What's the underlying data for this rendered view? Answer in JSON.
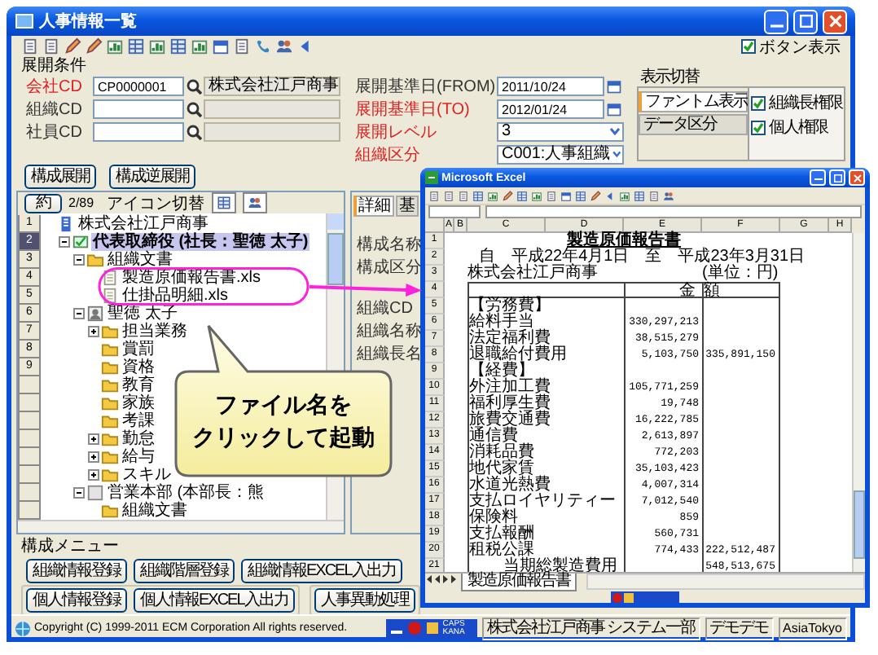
{
  "window": {
    "title": "人事情報一覧"
  },
  "button_display": {
    "label": "ボタン表示",
    "checked": true
  },
  "conditions": {
    "heading": "展開条件",
    "left": [
      {
        "label": "会社CD",
        "required": true,
        "value": "CP0000001",
        "name": "株式会社江戸商事"
      },
      {
        "label": "組織CD",
        "required": false
      },
      {
        "label": "社員CD",
        "required": false
      }
    ],
    "right": [
      {
        "label": "展開基準日(FROM)",
        "required": false,
        "kind": "date",
        "value": "2011/10/24"
      },
      {
        "label": "展開基準日(TO)",
        "required": true,
        "kind": "date",
        "value": "2012/01/24"
      },
      {
        "label": "展開レベル",
        "required": true,
        "kind": "select",
        "value": "3"
      },
      {
        "label": "組織区分",
        "required": true,
        "kind": "select",
        "value": "C001:人事組織"
      }
    ]
  },
  "display_switch": {
    "heading": "表示切替",
    "tabs": [
      {
        "label": "ファントム表示",
        "selected": true
      },
      {
        "label": "データ区分",
        "selected": false
      }
    ],
    "options": [
      {
        "label": "組織長権限",
        "checked": true
      },
      {
        "label": "個人権限",
        "checked": true
      }
    ]
  },
  "expand_buttons": [
    "構成展開",
    "構成逆展開"
  ],
  "tree_nav": {
    "button": "約",
    "counter": "2/89",
    "icon_switch": "アイコン切替"
  },
  "tree": {
    "line_numbers": [
      "1",
      "2",
      "3",
      "4",
      "5",
      "6",
      "7",
      "8",
      "9"
    ],
    "items": [
      {
        "label": "株式会社江戸商事",
        "kind": "company",
        "selected": false,
        "children": [
          {
            "label": "代表取締役 (社長：聖徳 太子)",
            "kind": "position",
            "selected": true,
            "expanded": true,
            "children": [
              {
                "label": "組織文書",
                "kind": "folder",
                "selected": false,
                "expanded": true,
                "children": [
                  {
                    "label": "製造原価報告書.xls",
                    "kind": "file",
                    "selected": false
                  },
                  {
                    "label": "仕掛品明細.xls",
                    "kind": "file",
                    "selected": false
                  }
                ]
              },
              {
                "label": "聖徳 太子",
                "kind": "person",
                "selected": false,
                "expanded": true,
                "children": [
                  {
                    "label": "担当業務",
                    "kind": "folder",
                    "selected": false,
                    "expanded": false
                  },
                  {
                    "label": "賞罰",
                    "kind": "folder",
                    "selected": false
                  },
                  {
                    "label": "資格",
                    "kind": "folder",
                    "selected": false
                  },
                  {
                    "label": "教育",
                    "kind": "folder",
                    "selected": false
                  },
                  {
                    "label": "家族",
                    "kind": "folder",
                    "selected": false
                  },
                  {
                    "label": "考課",
                    "kind": "folder",
                    "selected": false
                  },
                  {
                    "label": "勤怠",
                    "kind": "folder",
                    "selected": false,
                    "expanded": false
                  },
                  {
                    "label": "給与",
                    "kind": "folder",
                    "selected": false,
                    "expanded": false
                  },
                  {
                    "label": "スキル",
                    "kind": "folder",
                    "selected": false,
                    "expanded": false
                  }
                ]
              },
              {
                "label": "営業本部 (本部長：熊",
                "kind": "department",
                "selected": false,
                "expanded": true,
                "children": [
                  {
                    "label": "組織文書",
                    "kind": "folder",
                    "selected": false
                  }
                ]
              }
            ]
          }
        ]
      }
    ]
  },
  "detail": {
    "tabs": [
      {
        "label": "詳細",
        "selected": true
      },
      {
        "label": "基",
        "selected": false
      }
    ],
    "fields": [
      "構成名称",
      "構成区分",
      "組織CD",
      "組織名称",
      "組織長名"
    ]
  },
  "menu": {
    "heading": "構成メニュー",
    "rows": [
      [
        [
          "組織情報登録",
          "組織階層登録",
          "組織情報EXCEL入出力"
        ]
      ],
      [
        [
          "個人情報登録",
          "個人情報EXCEL入出力"
        ],
        [
          "人事異動処理"
        ]
      ]
    ]
  },
  "status_bar": {
    "copyright": "Copyright (C) 1999-2011 ECM Corporation All rights reserved.",
    "ime": [
      "CAPS",
      "KANA"
    ],
    "segments": [
      "株式会社江戸商事 システム一部",
      "デモデモ",
      "AsiaTokyo"
    ]
  },
  "excel": {
    "title": "Microsoft Excel",
    "column_headers": [
      "A",
      "B",
      "C",
      "D",
      "E",
      "F",
      "G",
      "H"
    ],
    "rows": [
      {
        "row": "1",
        "kind": "title",
        "label": "製造原価報告書"
      },
      {
        "row": "2",
        "kind": "period",
        "label": "自　平成22年4月1日　至　平成23年3月31日"
      },
      {
        "row": "3",
        "kind": "meta",
        "label": "株式会社江戸商事",
        "v2": "(単位：円)"
      },
      {
        "row": "4",
        "kind": "header",
        "v1": "金",
        "v2": "額"
      },
      {
        "row": "5",
        "kind": "item",
        "label": "【労務費】"
      },
      {
        "row": "6",
        "kind": "item",
        "label": "給料手当",
        "v1": "330,297,213"
      },
      {
        "row": "7",
        "kind": "item",
        "label": "法定福利費",
        "v1": "38,515,279"
      },
      {
        "row": "8",
        "kind": "item",
        "label": "退職給付費用",
        "v1": "5,103,750",
        "v2": "335,891,150"
      },
      {
        "row": "9",
        "kind": "item",
        "label": "【経費】"
      },
      {
        "row": "10",
        "kind": "item",
        "label": "外注加工費",
        "v1": "105,771,259"
      },
      {
        "row": "11",
        "kind": "item",
        "label": "福利厚生費",
        "v1": "19,748"
      },
      {
        "row": "12",
        "kind": "item",
        "label": "旅費交通費",
        "v1": "16,222,785"
      },
      {
        "row": "13",
        "kind": "item",
        "label": "通信費",
        "v1": "2,613,897"
      },
      {
        "row": "14",
        "kind": "item",
        "label": "消耗品費",
        "v1": "772,203"
      },
      {
        "row": "15",
        "kind": "item",
        "label": "地代家賃",
        "v1": "35,103,423"
      },
      {
        "row": "16",
        "kind": "item",
        "label": "水道光熱費",
        "v1": "4,007,314"
      },
      {
        "row": "17",
        "kind": "item",
        "label": "支払ロイヤリティー",
        "v1": "7,012,540"
      },
      {
        "row": "18",
        "kind": "item",
        "label": "保険料",
        "v1": "859"
      },
      {
        "row": "19",
        "kind": "item",
        "label": "支払報酬",
        "v1": "560,731"
      },
      {
        "row": "20",
        "kind": "item",
        "label": "租税公課",
        "v1": "774,433",
        "v2": "222,512,487"
      },
      {
        "row": "21",
        "kind": "total",
        "label": "当期総製造費用",
        "v2": "548,513,675"
      }
    ],
    "sheet_tabs": [
      {
        "label": "製造原価報告書",
        "selected": true
      }
    ]
  },
  "callout": {
    "lines": [
      "ファイル名を",
      "クリックして起動"
    ]
  }
}
